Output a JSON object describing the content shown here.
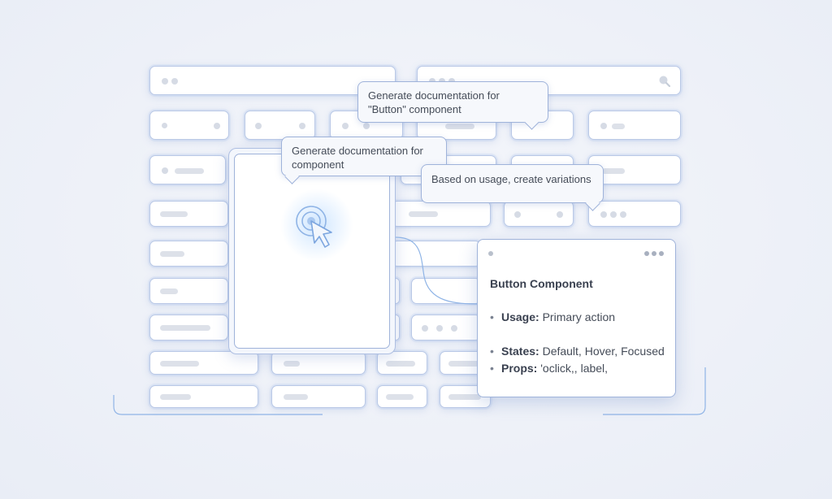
{
  "bubbles": {
    "button_doc": "Generate documentation for \"Button\" component",
    "component_doc": "Generate documentation for component",
    "variations": "Based on usage, create variations"
  },
  "doc_panel": {
    "title": "Button Component",
    "usage_key": "Usage:",
    "usage_value": "Primary action",
    "states_key": "States:",
    "states_value": "Default, Hover, Focused",
    "props_key": "Props:",
    "props_value": "'oclick,, label,",
    "bullet": "•"
  },
  "colors": {
    "accent": "#8fb4e6",
    "border": "#b9c8e6",
    "background": "#eef1f8"
  },
  "icons": {
    "cursor": "cursor-click-icon",
    "search": "search-icon",
    "menu": "more-dots-icon"
  }
}
